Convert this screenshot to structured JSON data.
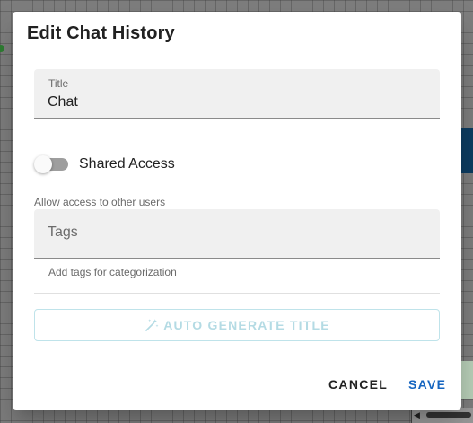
{
  "dialog": {
    "title": "Edit Chat History",
    "title_field": {
      "label": "Title",
      "value": "Chat"
    },
    "shared_access": {
      "label": "Shared Access",
      "enabled": false,
      "helper": "Allow access to other users"
    },
    "tags_field": {
      "placeholder": "Tags",
      "value": "",
      "helper": "Add tags for categorization"
    },
    "auto_generate": {
      "label": "AUTO GENERATE TITLE",
      "icon": "magic-wand-icon",
      "disabled": true
    },
    "actions": {
      "cancel": "CANCEL",
      "save": "SAVE"
    }
  },
  "colors": {
    "primary": "#1565c0",
    "disabled_accent": "#b4dbe4",
    "backdrop": "#7d7d7d"
  }
}
